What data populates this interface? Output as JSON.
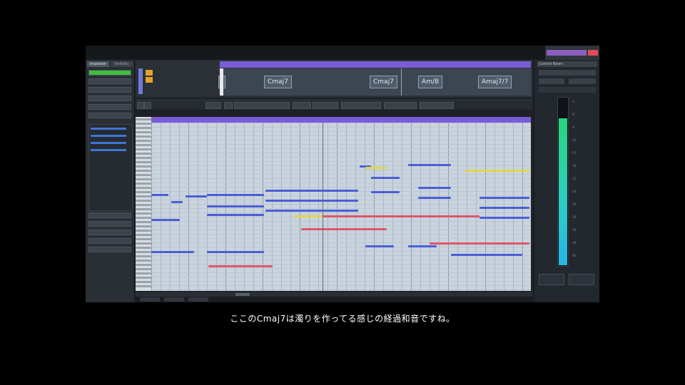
{
  "left_tabs": [
    "Inspector",
    "Visibility"
  ],
  "inspector_items": [
    "",
    "",
    "",
    "",
    "",
    ""
  ],
  "chords": [
    {
      "label": "Cmaj7"
    },
    {
      "label": "Cmaj7"
    },
    {
      "label": "Am/B"
    },
    {
      "label": "Amaj7/7"
    }
  ],
  "right_panel": {
    "title": "Control Room",
    "scale": [
      "-3",
      "-6",
      "-9",
      "-12",
      "-15",
      "-18",
      "-21",
      "-24",
      "-30",
      "-36",
      "-42",
      "-48",
      "-60"
    ],
    "buttons": [
      "",
      ""
    ]
  },
  "meter_level": 0.88,
  "colors": {
    "ruler": "#7a5bd8",
    "note_blue": "#4a5fd6",
    "note_red": "#e0566a",
    "note_yellow": "#e6d44a",
    "meter_green": "#27d67a",
    "meter_cyan": "#2ab3e6"
  },
  "subtitle": "ここのCmaj7は濁りを作ってる感じの経過和音ですね。"
}
